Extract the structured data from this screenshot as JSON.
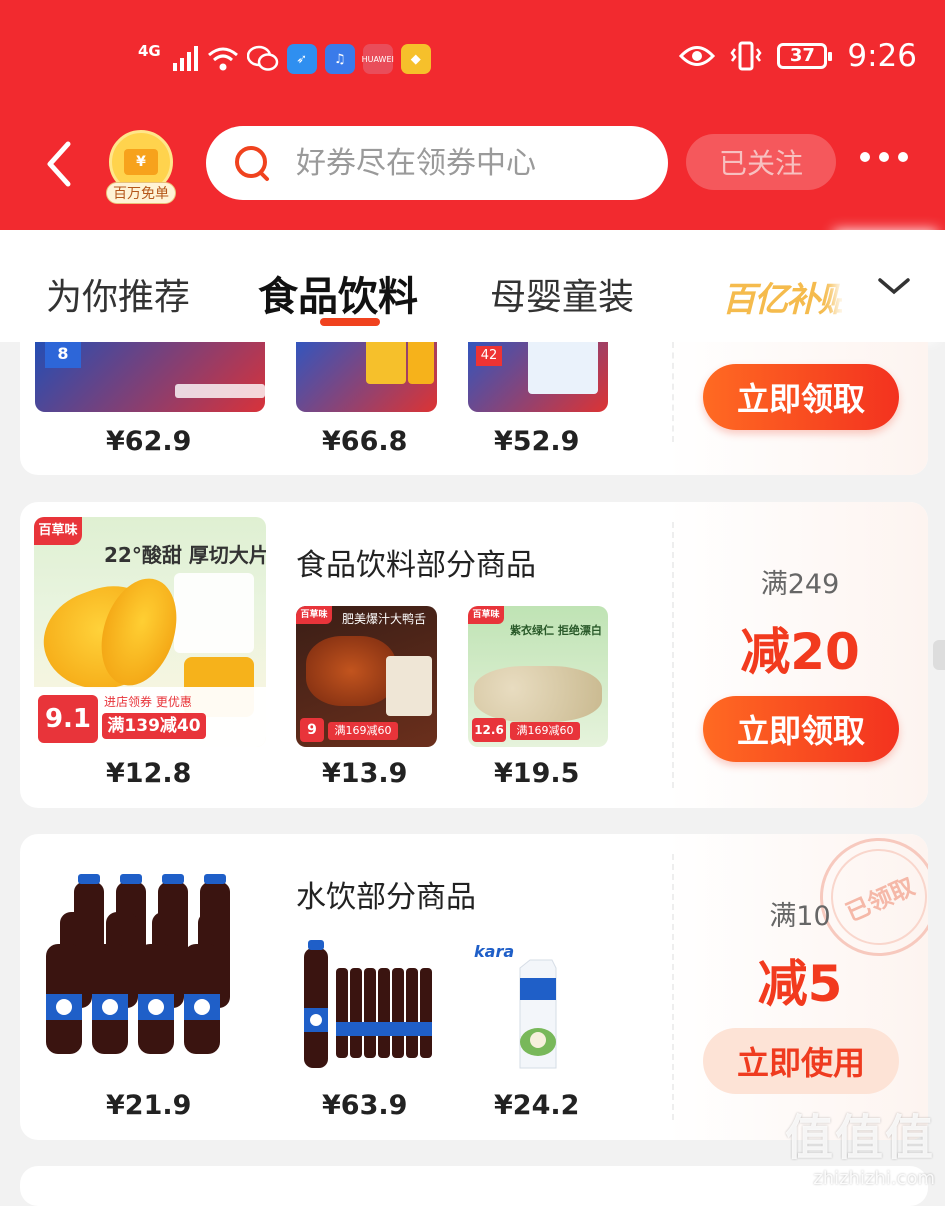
{
  "status_bar": {
    "network": "4G",
    "battery": "37",
    "time": "9:26",
    "app_icons": [
      "signal-icon",
      "wifi-icon",
      "wechat-icon",
      "feather-app-icon",
      "music-app-icon",
      "huawei-app-icon",
      "diamond-app-icon"
    ]
  },
  "header": {
    "badge_label": "百万免单",
    "search_placeholder": "好券尽在领券中心",
    "follow_label": "已关注"
  },
  "tabs": {
    "items": [
      {
        "label": "为你推荐"
      },
      {
        "label": "食品饮料",
        "active": true
      },
      {
        "label": "母婴童装"
      },
      {
        "label": "百亿补贴"
      }
    ]
  },
  "cards": [
    {
      "title": "",
      "prices": [
        "¥62.9",
        "¥66.8",
        "¥52.9"
      ],
      "button": "立即领取"
    },
    {
      "title": "食品饮料部分商品",
      "prices": [
        "¥12.8",
        "¥13.9",
        "¥19.5"
      ],
      "condition": "满249",
      "discount": "减20",
      "button": "立即领取",
      "thumb_texts": {
        "brand": "百草味",
        "main_headline": "22°酸甜 厚切大片",
        "main_price_tag": "9.1",
        "main_promo": "满139减40",
        "main_promo_sub": "进店领券 更优惠",
        "item2_headline": "肥美爆汁大鸭舌",
        "item2_price": "9",
        "item2_promo": "满169减60",
        "item3_headline": "紫衣绿仁 拒绝漂白",
        "item3_price": "12.6",
        "item3_promo": "满169减60"
      }
    },
    {
      "title": "水饮部分商品",
      "prices": [
        "¥21.9",
        "¥63.9",
        "¥24.2"
      ],
      "condition": "满10",
      "discount": "减5",
      "button": "立即使用",
      "stamp": "已领取",
      "thumb_texts": {
        "kara_brand": "kara"
      }
    }
  ],
  "watermark": {
    "big": "值值值",
    "small": "zhizhizhi.com"
  },
  "colors": {
    "brand_red": "#f22a2f",
    "accent_orange": "#f3321f",
    "discount_red": "#f23a1e"
  }
}
